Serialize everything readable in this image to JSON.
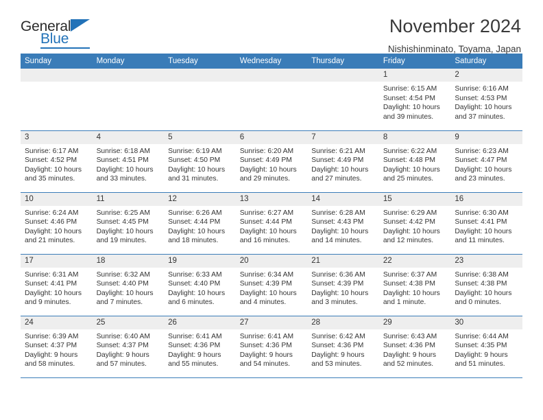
{
  "brand": {
    "name_part1": "General",
    "name_part2": "Blue"
  },
  "header": {
    "title": "November 2024",
    "location": "Nishishinminato, Toyama, Japan"
  },
  "colors": {
    "header_blue": "#3a7cb8",
    "daynum_band": "#eeeeee",
    "text": "#333333",
    "brand_blue": "#2272b8"
  },
  "weekday_headers": [
    "Sunday",
    "Monday",
    "Tuesday",
    "Wednesday",
    "Thursday",
    "Friday",
    "Saturday"
  ],
  "weeks": [
    [
      {
        "day": "",
        "empty": true
      },
      {
        "day": "",
        "empty": true
      },
      {
        "day": "",
        "empty": true
      },
      {
        "day": "",
        "empty": true
      },
      {
        "day": "",
        "empty": true
      },
      {
        "day": "1",
        "sunrise": "Sunrise: 6:15 AM",
        "sunset": "Sunset: 4:54 PM",
        "daylight": "Daylight: 10 hours and 39 minutes."
      },
      {
        "day": "2",
        "sunrise": "Sunrise: 6:16 AM",
        "sunset": "Sunset: 4:53 PM",
        "daylight": "Daylight: 10 hours and 37 minutes."
      }
    ],
    [
      {
        "day": "3",
        "sunrise": "Sunrise: 6:17 AM",
        "sunset": "Sunset: 4:52 PM",
        "daylight": "Daylight: 10 hours and 35 minutes."
      },
      {
        "day": "4",
        "sunrise": "Sunrise: 6:18 AM",
        "sunset": "Sunset: 4:51 PM",
        "daylight": "Daylight: 10 hours and 33 minutes."
      },
      {
        "day": "5",
        "sunrise": "Sunrise: 6:19 AM",
        "sunset": "Sunset: 4:50 PM",
        "daylight": "Daylight: 10 hours and 31 minutes."
      },
      {
        "day": "6",
        "sunrise": "Sunrise: 6:20 AM",
        "sunset": "Sunset: 4:49 PM",
        "daylight": "Daylight: 10 hours and 29 minutes."
      },
      {
        "day": "7",
        "sunrise": "Sunrise: 6:21 AM",
        "sunset": "Sunset: 4:49 PM",
        "daylight": "Daylight: 10 hours and 27 minutes."
      },
      {
        "day": "8",
        "sunrise": "Sunrise: 6:22 AM",
        "sunset": "Sunset: 4:48 PM",
        "daylight": "Daylight: 10 hours and 25 minutes."
      },
      {
        "day": "9",
        "sunrise": "Sunrise: 6:23 AM",
        "sunset": "Sunset: 4:47 PM",
        "daylight": "Daylight: 10 hours and 23 minutes."
      }
    ],
    [
      {
        "day": "10",
        "sunrise": "Sunrise: 6:24 AM",
        "sunset": "Sunset: 4:46 PM",
        "daylight": "Daylight: 10 hours and 21 minutes."
      },
      {
        "day": "11",
        "sunrise": "Sunrise: 6:25 AM",
        "sunset": "Sunset: 4:45 PM",
        "daylight": "Daylight: 10 hours and 19 minutes."
      },
      {
        "day": "12",
        "sunrise": "Sunrise: 6:26 AM",
        "sunset": "Sunset: 4:44 PM",
        "daylight": "Daylight: 10 hours and 18 minutes."
      },
      {
        "day": "13",
        "sunrise": "Sunrise: 6:27 AM",
        "sunset": "Sunset: 4:44 PM",
        "daylight": "Daylight: 10 hours and 16 minutes."
      },
      {
        "day": "14",
        "sunrise": "Sunrise: 6:28 AM",
        "sunset": "Sunset: 4:43 PM",
        "daylight": "Daylight: 10 hours and 14 minutes."
      },
      {
        "day": "15",
        "sunrise": "Sunrise: 6:29 AM",
        "sunset": "Sunset: 4:42 PM",
        "daylight": "Daylight: 10 hours and 12 minutes."
      },
      {
        "day": "16",
        "sunrise": "Sunrise: 6:30 AM",
        "sunset": "Sunset: 4:41 PM",
        "daylight": "Daylight: 10 hours and 11 minutes."
      }
    ],
    [
      {
        "day": "17",
        "sunrise": "Sunrise: 6:31 AM",
        "sunset": "Sunset: 4:41 PM",
        "daylight": "Daylight: 10 hours and 9 minutes."
      },
      {
        "day": "18",
        "sunrise": "Sunrise: 6:32 AM",
        "sunset": "Sunset: 4:40 PM",
        "daylight": "Daylight: 10 hours and 7 minutes."
      },
      {
        "day": "19",
        "sunrise": "Sunrise: 6:33 AM",
        "sunset": "Sunset: 4:40 PM",
        "daylight": "Daylight: 10 hours and 6 minutes."
      },
      {
        "day": "20",
        "sunrise": "Sunrise: 6:34 AM",
        "sunset": "Sunset: 4:39 PM",
        "daylight": "Daylight: 10 hours and 4 minutes."
      },
      {
        "day": "21",
        "sunrise": "Sunrise: 6:36 AM",
        "sunset": "Sunset: 4:39 PM",
        "daylight": "Daylight: 10 hours and 3 minutes."
      },
      {
        "day": "22",
        "sunrise": "Sunrise: 6:37 AM",
        "sunset": "Sunset: 4:38 PM",
        "daylight": "Daylight: 10 hours and 1 minute."
      },
      {
        "day": "23",
        "sunrise": "Sunrise: 6:38 AM",
        "sunset": "Sunset: 4:38 PM",
        "daylight": "Daylight: 10 hours and 0 minutes."
      }
    ],
    [
      {
        "day": "24",
        "sunrise": "Sunrise: 6:39 AM",
        "sunset": "Sunset: 4:37 PM",
        "daylight": "Daylight: 9 hours and 58 minutes."
      },
      {
        "day": "25",
        "sunrise": "Sunrise: 6:40 AM",
        "sunset": "Sunset: 4:37 PM",
        "daylight": "Daylight: 9 hours and 57 minutes."
      },
      {
        "day": "26",
        "sunrise": "Sunrise: 6:41 AM",
        "sunset": "Sunset: 4:36 PM",
        "daylight": "Daylight: 9 hours and 55 minutes."
      },
      {
        "day": "27",
        "sunrise": "Sunrise: 6:41 AM",
        "sunset": "Sunset: 4:36 PM",
        "daylight": "Daylight: 9 hours and 54 minutes."
      },
      {
        "day": "28",
        "sunrise": "Sunrise: 6:42 AM",
        "sunset": "Sunset: 4:36 PM",
        "daylight": "Daylight: 9 hours and 53 minutes."
      },
      {
        "day": "29",
        "sunrise": "Sunrise: 6:43 AM",
        "sunset": "Sunset: 4:36 PM",
        "daylight": "Daylight: 9 hours and 52 minutes."
      },
      {
        "day": "30",
        "sunrise": "Sunrise: 6:44 AM",
        "sunset": "Sunset: 4:35 PM",
        "daylight": "Daylight: 9 hours and 51 minutes."
      }
    ]
  ]
}
